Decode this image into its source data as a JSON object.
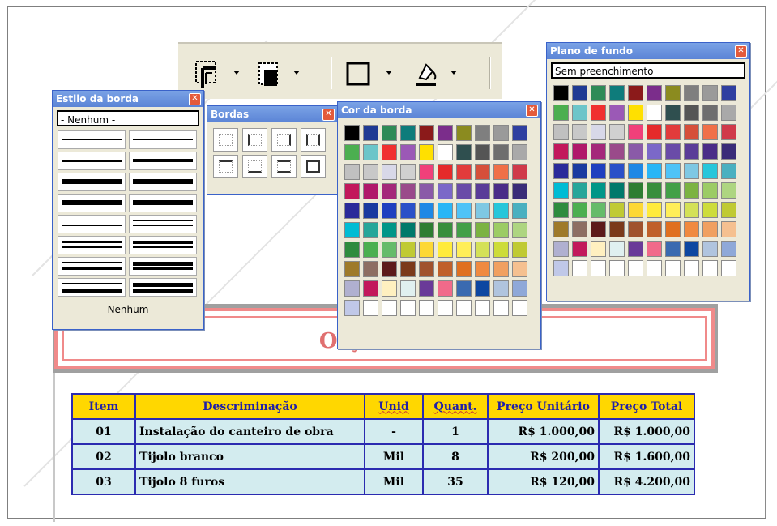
{
  "estilo_panel": {
    "title": "Estilo da borda",
    "selected": "- Nenhum -",
    "footer": "- Nenhum -"
  },
  "bordas_panel": {
    "title": "Bordas"
  },
  "cor_panel": {
    "title": "Cor da borda",
    "colors": [
      "#000000",
      "#1f3a93",
      "#2e8b57",
      "#0e7c7b",
      "#8b1a1a",
      "#7b2d8b",
      "#8b8b1f",
      "#7f7f7f",
      "#9a9a9a",
      "#2f3fa0",
      "#4caf50",
      "#6cc5c9",
      "#f03030",
      "#9b59b6",
      "#ffe000",
      "#ffffff",
      "#2f4f4f",
      "#555555",
      "#6e6e6e",
      "#a9a9a9",
      "#c0c0c0",
      "#c8c8c8",
      "#d8d8e8",
      "#d0d0d0",
      "#f0407a",
      "#e52a2a",
      "#e23b3b",
      "#d64f3a",
      "#f07048",
      "#d03a4a",
      "#c2185b",
      "#b0186a",
      "#a4287a",
      "#9a4a8a",
      "#8a5aa8",
      "#7b68c8",
      "#6a4ca8",
      "#5a3c98",
      "#4a2c88",
      "#3a2c78",
      "#2a2a9a",
      "#1a3aa0",
      "#1f3fbf",
      "#2a50c8",
      "#1e88e5",
      "#29b6f6",
      "#4fc3f7",
      "#7ec8e3",
      "#26c6da",
      "#4ab0c0",
      "#00bcd4",
      "#26a69a",
      "#009688",
      "#00796b",
      "#2e7d32",
      "#388e3c",
      "#43a047",
      "#7cb342",
      "#9ccc65",
      "#aed581",
      "#2e8b3e",
      "#4caf50",
      "#66bb6a",
      "#c0ca33",
      "#fdd835",
      "#ffeb3b",
      "#ffee58",
      "#d4e157",
      "#cddc39",
      "#c0ca33",
      "#9e7a2a",
      "#8d6e63",
      "#5d1a1a",
      "#7b3a1a",
      "#a0522d",
      "#c0602a",
      "#e07020",
      "#f08a40",
      "#f0a060",
      "#f5c090",
      "#b0b0d0",
      "#c2185b",
      "#fff0c0",
      "#e0f0f0",
      "#6a3a98",
      "#f06a8a",
      "#3a6ab0",
      "#0d47a1",
      "#b0c4de",
      "#8fa8d8",
      "#c0c8e8",
      "#ffffff",
      "#ffffff",
      "#ffffff",
      "#ffffff",
      "#ffffff",
      "#ffffff",
      "#ffffff",
      "#ffffff",
      "#ffffff"
    ]
  },
  "plano_panel": {
    "title": "Plano de fundo",
    "selected": "Sem preenchimento",
    "colors": [
      "#000000",
      "#1f3a93",
      "#2e8b57",
      "#0e7c7b",
      "#8b1a1a",
      "#7b2d8b",
      "#8b8b1f",
      "#7f7f7f",
      "#9a9a9a",
      "#2f3fa0",
      "#4caf50",
      "#6cc5c9",
      "#f03030",
      "#9b59b6",
      "#ffe000",
      "#ffffff",
      "#2f4f4f",
      "#555555",
      "#6e6e6e",
      "#a9a9a9",
      "#c0c0c0",
      "#c8c8c8",
      "#d8d8e8",
      "#d0d0d0",
      "#f0407a",
      "#e52a2a",
      "#e23b3b",
      "#d64f3a",
      "#f07048",
      "#d03a4a",
      "#c2185b",
      "#b0186a",
      "#a4287a",
      "#9a4a8a",
      "#8a5aa8",
      "#7b68c8",
      "#6a4ca8",
      "#5a3c98",
      "#4a2c88",
      "#3a2c78",
      "#2a2a9a",
      "#1a3aa0",
      "#1f3fbf",
      "#2a50c8",
      "#1e88e5",
      "#29b6f6",
      "#4fc3f7",
      "#7ec8e3",
      "#26c6da",
      "#4ab0c0",
      "#00bcd4",
      "#26a69a",
      "#009688",
      "#00796b",
      "#2e7d32",
      "#388e3c",
      "#43a047",
      "#7cb342",
      "#9ccc65",
      "#aed581",
      "#2e8b3e",
      "#4caf50",
      "#66bb6a",
      "#c0ca33",
      "#fdd835",
      "#ffeb3b",
      "#ffee58",
      "#d4e157",
      "#cddc39",
      "#c0ca33",
      "#9e7a2a",
      "#8d6e63",
      "#5d1a1a",
      "#7b3a1a",
      "#a0522d",
      "#c0602a",
      "#e07020",
      "#f08a40",
      "#f0a060",
      "#f5c090",
      "#b0b0d0",
      "#c2185b",
      "#fff0c0",
      "#e0f0f0",
      "#6a3a98",
      "#f06a8a",
      "#3a6ab0",
      "#0d47a1",
      "#b0c4de",
      "#8fa8d8",
      "#c0c8e8",
      "#ffffff",
      "#ffffff",
      "#ffffff",
      "#ffffff",
      "#ffffff",
      "#ffffff",
      "#ffffff",
      "#ffffff",
      "#ffffff"
    ]
  },
  "document": {
    "title": "Orçamento",
    "headers": [
      "Item",
      "Descriminação",
      "Unid",
      "Quant.",
      "Preço Unitário",
      "Preço Total"
    ],
    "rows": [
      [
        "01",
        "Instalação do canteiro de obra",
        "-",
        "1",
        "R$ 1.000,00",
        "R$ 1.000,00"
      ],
      [
        "02",
        "Tijolo branco",
        "Mil",
        "8",
        "R$ 200,00",
        "R$ 1.600,00"
      ],
      [
        "03",
        "Tijolo 8 furos",
        "Mil",
        "35",
        "R$ 120,00",
        "R$ 4.200,00"
      ]
    ]
  },
  "colors": {
    "header_bg": "#ffd700",
    "header_text": "#1f1fa8",
    "cell_bg": "#d3ecef",
    "table_border": "#2b2bb0",
    "title_frame": "#f08a8a",
    "titlebar": "#5b84d6"
  },
  "icons": {
    "close": "close-icon",
    "borders": "borders-icon",
    "border_fill": "border-color-icon",
    "outline": "outline-icon",
    "paint_bucket": "paint-bucket-icon"
  }
}
